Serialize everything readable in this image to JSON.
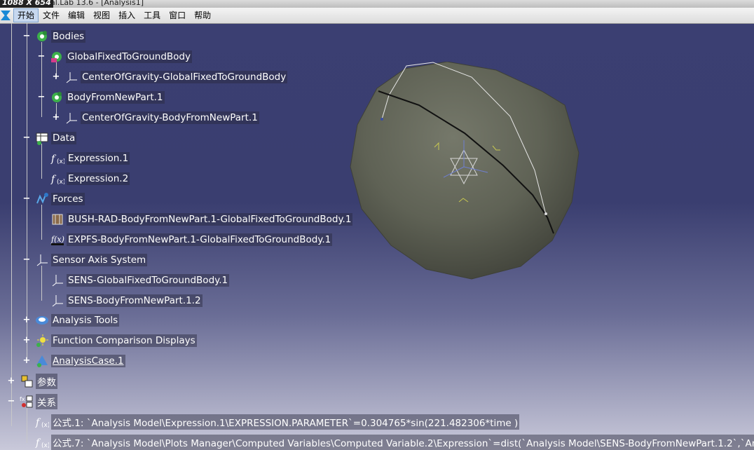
{
  "window": {
    "coords": "1088 X 654",
    "title": "al.Lab 13.6 - [Analysis1]"
  },
  "menu": [
    "开始",
    "文件",
    "编辑",
    "视图",
    "插入",
    "工具",
    "窗口",
    "帮助"
  ],
  "tree": {
    "bodies": "Bodies",
    "global_fixed": "GlobalFixedToGroundBody",
    "cog_global": "CenterOfGravity-GlobalFixedToGroundBody",
    "body_new": "BodyFromNewPart.1",
    "cog_body": "CenterOfGravity-BodyFromNewPart.1",
    "data": "Data",
    "expr1": "Expression.1",
    "expr2": "Expression.2",
    "forces": "Forces",
    "bush": "BUSH-RAD-BodyFromNewPart.1-GlobalFixedToGroundBody.1",
    "expfs": "EXPFS-BodyFromNewPart.1-GlobalFixedToGroundBody.1",
    "sensor": "Sensor Axis System",
    "sens_global": "SENS-GlobalFixedToGroundBody.1",
    "sens_body": "SENS-BodyFromNewPart.1.2",
    "analysis_tools": "Analysis Tools",
    "func_compare": "Function Comparison Displays",
    "analysis_case": "AnalysisCase.1",
    "params": "参数",
    "relations": "关系",
    "formula1": "公式.1: `Analysis Model\\Expression.1\\EXPRESSION.PARAMETER`=0.304765*sin(221.482306*time )",
    "formula7": "公式.7: `Analysis Model\\Plots Manager\\Computed Variables\\Computed Variable.2\\Expression`=dist(`Analysis Model\\SENS-BodyFromNewPart.1.2`,`An"
  },
  "colors": {
    "background_top": "#3b3f72",
    "background_bottom": "#c9c9da",
    "sphere": "#5f6255",
    "label_text": "#ffffff"
  },
  "icons": {
    "bodies": "gear-cluster-icon",
    "cog": "axis-system-icon",
    "data": "data-table-icon",
    "expression": "fx-icon",
    "forces": "force-spring-icon",
    "bush": "bushing-icon",
    "expfs": "expression-force-icon",
    "sensor": "axis-system-icon",
    "analysis_tools": "analysis-tools-icon",
    "func_compare": "sun-chart-icon",
    "analysis_case": "analysis-case-icon",
    "params": "parameters-icon",
    "relations": "relations-icon"
  }
}
